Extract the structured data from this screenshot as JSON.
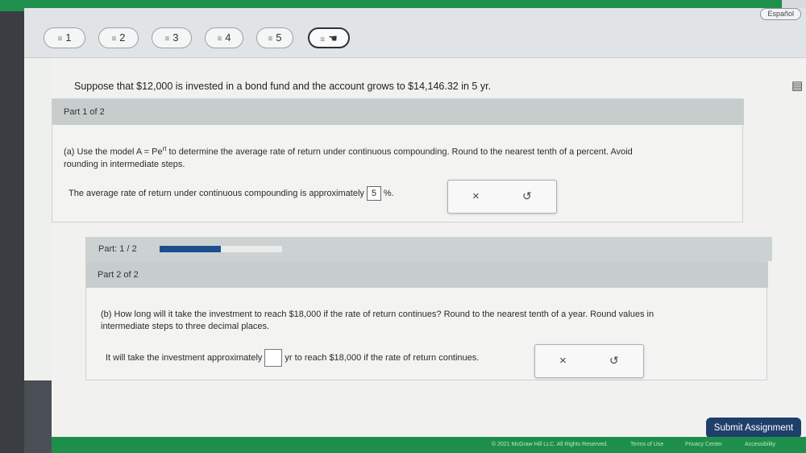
{
  "header": {
    "language_button": "Español",
    "question_nav": [
      {
        "label": "1"
      },
      {
        "label": "2"
      },
      {
        "label": "3"
      },
      {
        "label": "4"
      },
      {
        "label": "5"
      },
      {
        "label": ""
      }
    ],
    "nav_glyph": "≡"
  },
  "question": {
    "text": "Suppose that $12,000 is invested in a bond fund and the account grows to $14,146.32 in 5 yr."
  },
  "part1": {
    "header": "Part 1 of 2",
    "instruction_line1": "(a) Use the model A = Pe",
    "instruction_exponent": "rt",
    "instruction_line1_rest": " to determine the average rate of return under continuous compounding. Round to the nearest tenth of a percent. Avoid",
    "instruction_line2": "rounding in intermediate steps.",
    "answer_prefix": "The average rate of return under continuous compounding is approximately",
    "answer_value": "5",
    "answer_suffix": "%."
  },
  "progress": {
    "label": "Part: 1 / 2",
    "value_fraction": 0.5
  },
  "part2": {
    "header": "Part 2 of 2",
    "instruction_line1": "(b) How long will it take the investment to reach $18,000 if the rate of return continues? Round to the nearest tenth of a year. Round values in",
    "instruction_line2": "intermediate steps to three decimal places.",
    "answer_prefix": "It will take the investment approximately",
    "answer_value": "",
    "answer_suffix": "yr to reach $18,000 if the rate of return continues."
  },
  "tools": {
    "clear_glyph": "×",
    "undo_glyph": "↺"
  },
  "submit_label": "Submit Assignment",
  "footer": {
    "copyright": "© 2021 McGraw Hill LLC. All Rights Reserved.",
    "terms": "Terms of Use",
    "privacy": "Privacy Center",
    "accessibility": "Accessibility"
  },
  "icons": {
    "question_icon": "notes-icon"
  }
}
